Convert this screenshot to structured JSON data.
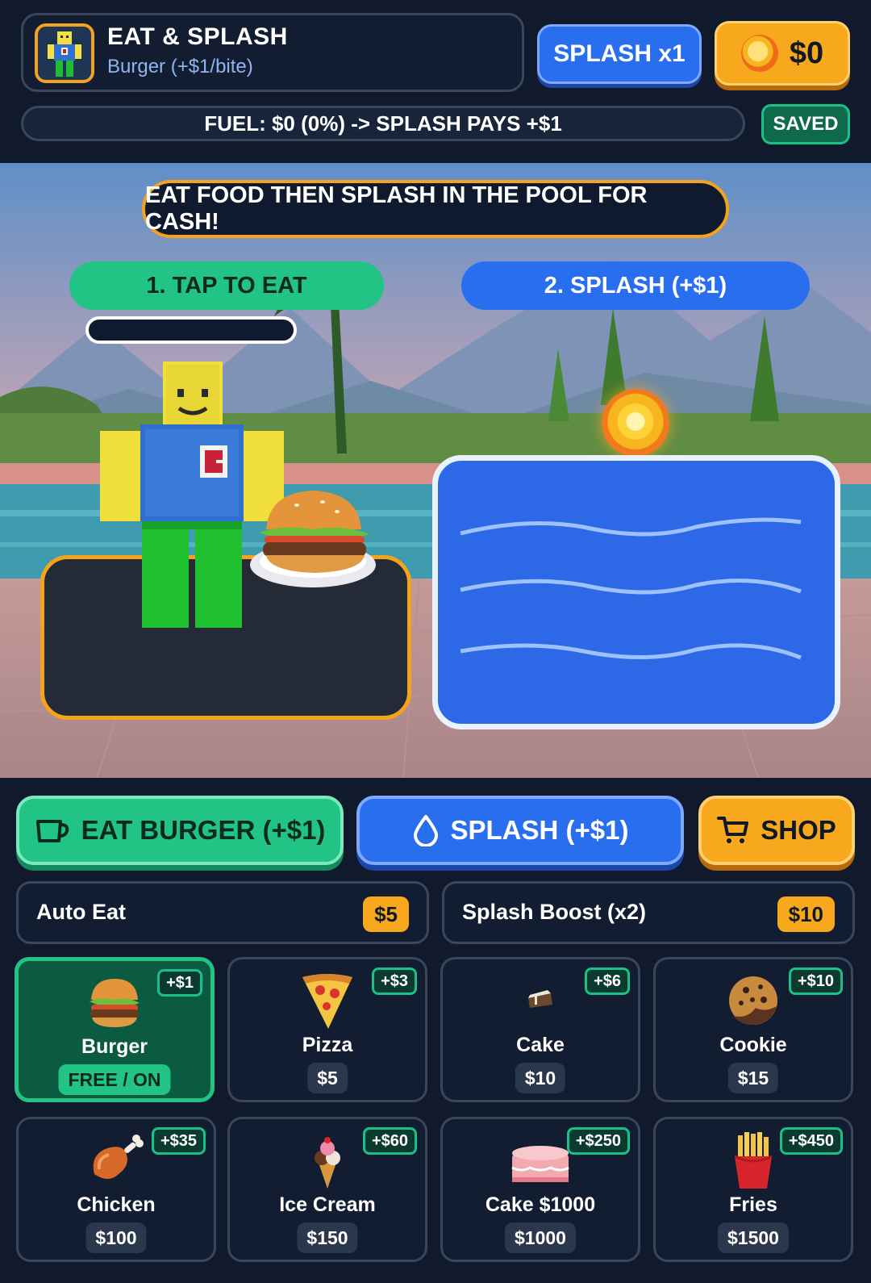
{
  "header": {
    "title": "EAT & SPLASH",
    "subtitle": "Burger (+$1/bite)",
    "splash_multiplier": "SPLASH x1",
    "cash": "$0",
    "fuel_text": "FUEL: $0 (0%) -> SPLASH PAYS +$1",
    "saved": "SAVED"
  },
  "scene": {
    "banner": "EAT FOOD THEN SPLASH IN THE POOL FOR CASH!",
    "step_eat": "1. TAP TO EAT",
    "step_splash": "2. SPLASH (+$1)",
    "eat_progress": 0
  },
  "actions": {
    "eat": "EAT BURGER (+$1)",
    "splash": "SPLASH (+$1)",
    "shop": "SHOP"
  },
  "upgrades": [
    {
      "label": "Auto Eat",
      "price": "$5"
    },
    {
      "label": "Splash Boost (x2)",
      "price": "$10"
    }
  ],
  "foods": [
    {
      "name": "Burger",
      "bonus": "+$1",
      "price": "FREE / ON",
      "icon": "burger-icon",
      "active": true
    },
    {
      "name": "Pizza",
      "bonus": "+$3",
      "price": "$5",
      "icon": "pizza-icon"
    },
    {
      "name": "Cake",
      "bonus": "+$6",
      "price": "$10",
      "icon": "cake-slice-icon"
    },
    {
      "name": "Cookie",
      "bonus": "+$10",
      "price": "$15",
      "icon": "cookie-icon"
    },
    {
      "name": "Chicken",
      "bonus": "+$35",
      "price": "$100",
      "icon": "chicken-leg-icon"
    },
    {
      "name": "Ice Cream",
      "bonus": "+$60",
      "price": "$150",
      "icon": "ice-cream-icon"
    },
    {
      "name": "Cake $1000",
      "bonus": "+$250",
      "price": "$1000",
      "icon": "big-cake-icon"
    },
    {
      "name": "Fries",
      "bonus": "+$450",
      "price": "$1500",
      "icon": "fries-icon"
    }
  ],
  "colors": {
    "accent_green": "#22c485",
    "accent_blue": "#2a6ef0",
    "accent_orange": "#f8a81c",
    "panel": "#131d31"
  }
}
